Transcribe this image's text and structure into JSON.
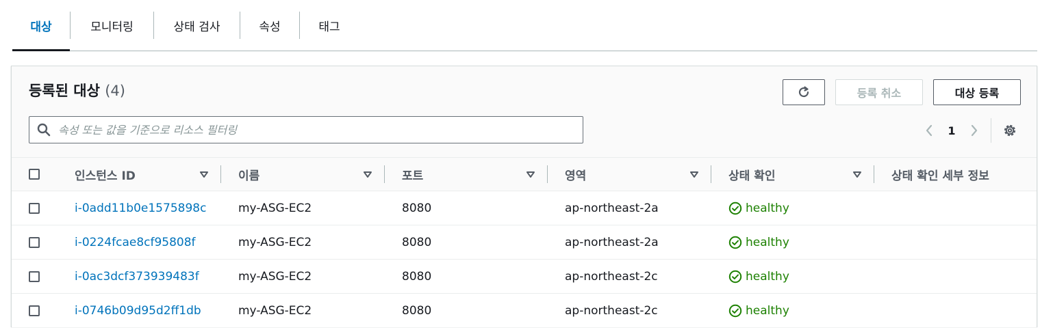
{
  "tabs": [
    {
      "label": "대상",
      "active": true
    },
    {
      "label": "모니터링",
      "active": false
    },
    {
      "label": "상태 검사",
      "active": false
    },
    {
      "label": "속성",
      "active": false
    },
    {
      "label": "태그",
      "active": false
    }
  ],
  "panel": {
    "title": "등록된 대상",
    "count": "(4)",
    "refresh_icon": "refresh-icon",
    "deregister_label": "등록 취소",
    "register_label": "대상 등록"
  },
  "search": {
    "placeholder": "속성 또는 값을 기준으로 리소스 필터링",
    "icon": "search-icon"
  },
  "pagination": {
    "current_page": "1"
  },
  "table": {
    "columns": [
      "인스턴스 ID",
      "이름",
      "포트",
      "영역",
      "상태 확인",
      "상태 확인 세부 정보"
    ],
    "rows": [
      {
        "instance_id": "i-0add11b0e1575898c",
        "name": "my-ASG-EC2",
        "port": "8080",
        "zone": "ap-northeast-2a",
        "health": "healthy",
        "details": ""
      },
      {
        "instance_id": "i-0224fcae8cf95808f",
        "name": "my-ASG-EC2",
        "port": "8080",
        "zone": "ap-northeast-2a",
        "health": "healthy",
        "details": ""
      },
      {
        "instance_id": "i-0ac3dcf373939483f",
        "name": "my-ASG-EC2",
        "port": "8080",
        "zone": "ap-northeast-2c",
        "health": "healthy",
        "details": ""
      },
      {
        "instance_id": "i-0746b09d95d2ff1db",
        "name": "my-ASG-EC2",
        "port": "8080",
        "zone": "ap-northeast-2c",
        "health": "healthy",
        "details": ""
      }
    ]
  },
  "colors": {
    "link": "#0073bb",
    "healthy": "#1d8102",
    "active_tab": "#0073bb"
  }
}
